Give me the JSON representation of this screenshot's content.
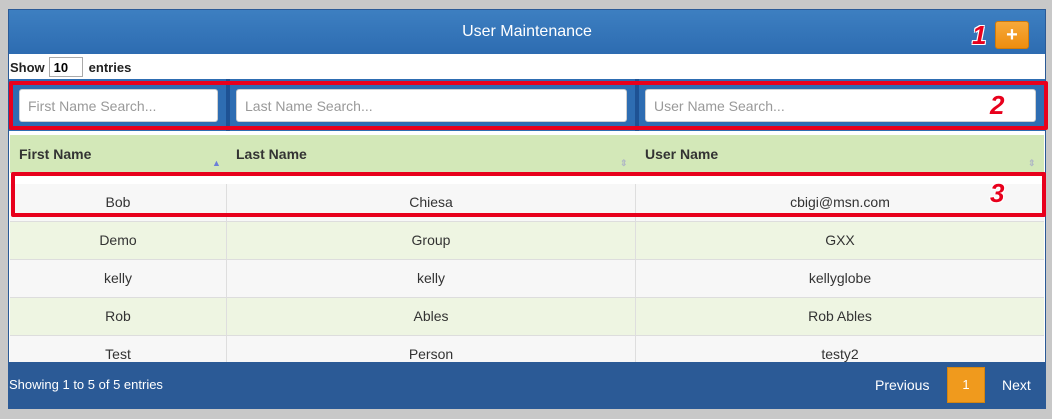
{
  "header": {
    "title": "User Maintenance",
    "add_label": "+"
  },
  "length": {
    "prefix": "Show",
    "value": "10",
    "suffix": "entries"
  },
  "search": {
    "first_placeholder": "First Name Search...",
    "last_placeholder": "Last Name Search...",
    "user_placeholder": "User Name Search..."
  },
  "columns": [
    "First Name",
    "Last Name",
    "User Name"
  ],
  "rows": [
    [
      "Bob",
      "Chiesa",
      "cbigi@msn.com"
    ],
    [
      "Demo",
      "Group",
      "GXX"
    ],
    [
      "kelly",
      "kelly",
      "kellyglobe"
    ],
    [
      "Rob",
      "Ables",
      "Rob Ables"
    ],
    [
      "Test",
      "Person",
      "testy2"
    ]
  ],
  "footer": {
    "info": "Showing 1 to 5 of 5 entries",
    "previous": "Previous",
    "page": "1",
    "next": "Next"
  },
  "markers": [
    "1",
    "2",
    "3"
  ],
  "colors": {
    "header": "#2d6cb1",
    "accent": "#f09a1d",
    "highlight": "#e8001c",
    "table_header": "#d3e8b8"
  }
}
